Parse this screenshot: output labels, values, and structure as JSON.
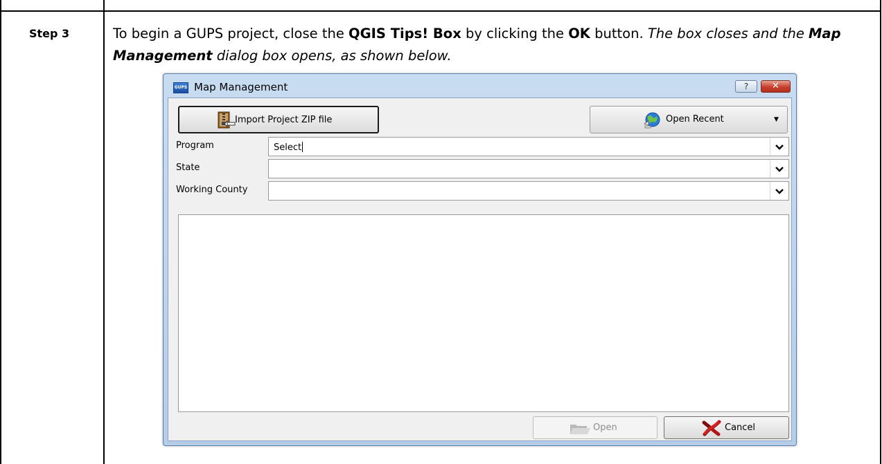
{
  "step": {
    "label": "Step 3"
  },
  "instructions": {
    "part1": "To begin a GUPS project, close the ",
    "bold1": "QGIS Tips! Box",
    "part2": " by clicking the ",
    "bold2": "OK",
    "part3": " button. ",
    "italic1": "The box closes and the ",
    "bold_italic": "Map Management",
    "italic2": " dialog box opens, as shown below."
  },
  "dialog": {
    "app_icon_text": "GUPS",
    "title": "Map Management",
    "help_label": "?",
    "close_label": "✕",
    "import_label": "Import Project ZIP file",
    "recent_label": "Open Recent",
    "recent_caret": "▼",
    "fields": [
      {
        "label": "Program",
        "value": "Select"
      },
      {
        "label": "State",
        "value": ""
      },
      {
        "label": "Working County",
        "value": ""
      }
    ],
    "open_label": "Open",
    "cancel_label": "Cancel"
  },
  "icons": {
    "zip": "zip-archive-icon",
    "globe": "globe-icon",
    "folder": "folder-icon",
    "cancel": "red-x-icon",
    "dropdown": "chevron-down-icon"
  }
}
